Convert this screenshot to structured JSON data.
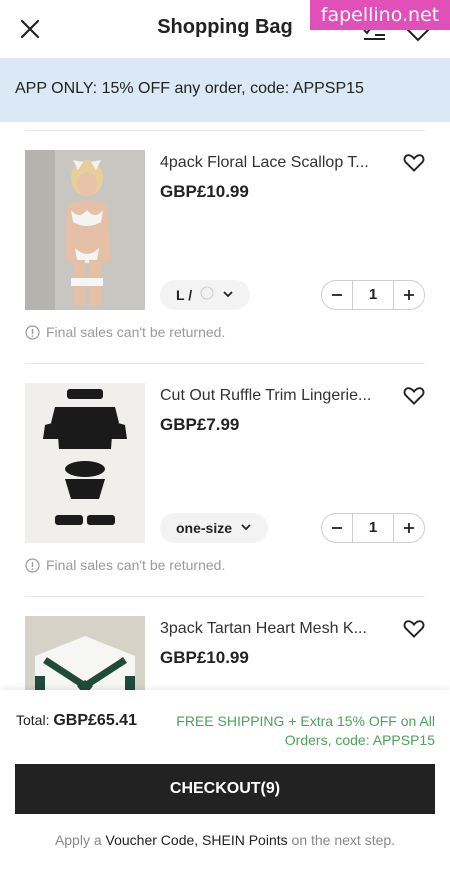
{
  "header": {
    "title": "Shopping Bag",
    "close_icon": "close-icon",
    "list_icon": "checklist-icon",
    "wishlist_icon": "heart-icon",
    "watermark": "fapellino.net"
  },
  "promo": {
    "text": "APP ONLY: 15% OFF any order, code: APPSP15"
  },
  "items": [
    {
      "name": "4pack Floral Lace Scallop T...",
      "price": "GBP£10.99",
      "variant": "L / ",
      "quantity": "1",
      "notice": "Final sales can't be returned."
    },
    {
      "name": "Cut Out Ruffle Trim Lingerie...",
      "price": "GBP£7.99",
      "variant": "one-size",
      "quantity": "1",
      "notice": "Final sales can't be returned."
    },
    {
      "name": "3pack Tartan Heart Mesh K...",
      "price": "GBP£10.99"
    }
  ],
  "footer": {
    "total_label": "Total:",
    "total_value": "GBP£65.41",
    "shipping": "FREE SHIPPING + Extra 15% OFF on All Orders, code: APPSP15",
    "checkout_label": "CHECKOUT(9)",
    "voucher": {
      "prefix": "Apply a ",
      "link": "Voucher Code, SHEIN Points",
      "suffix": " on the next step."
    }
  },
  "colors": {
    "promo_bg": "#dbe9f7",
    "accent_green": "#4ca25a",
    "checkout_bg": "#222222",
    "watermark_bg": "#e14fb9"
  }
}
